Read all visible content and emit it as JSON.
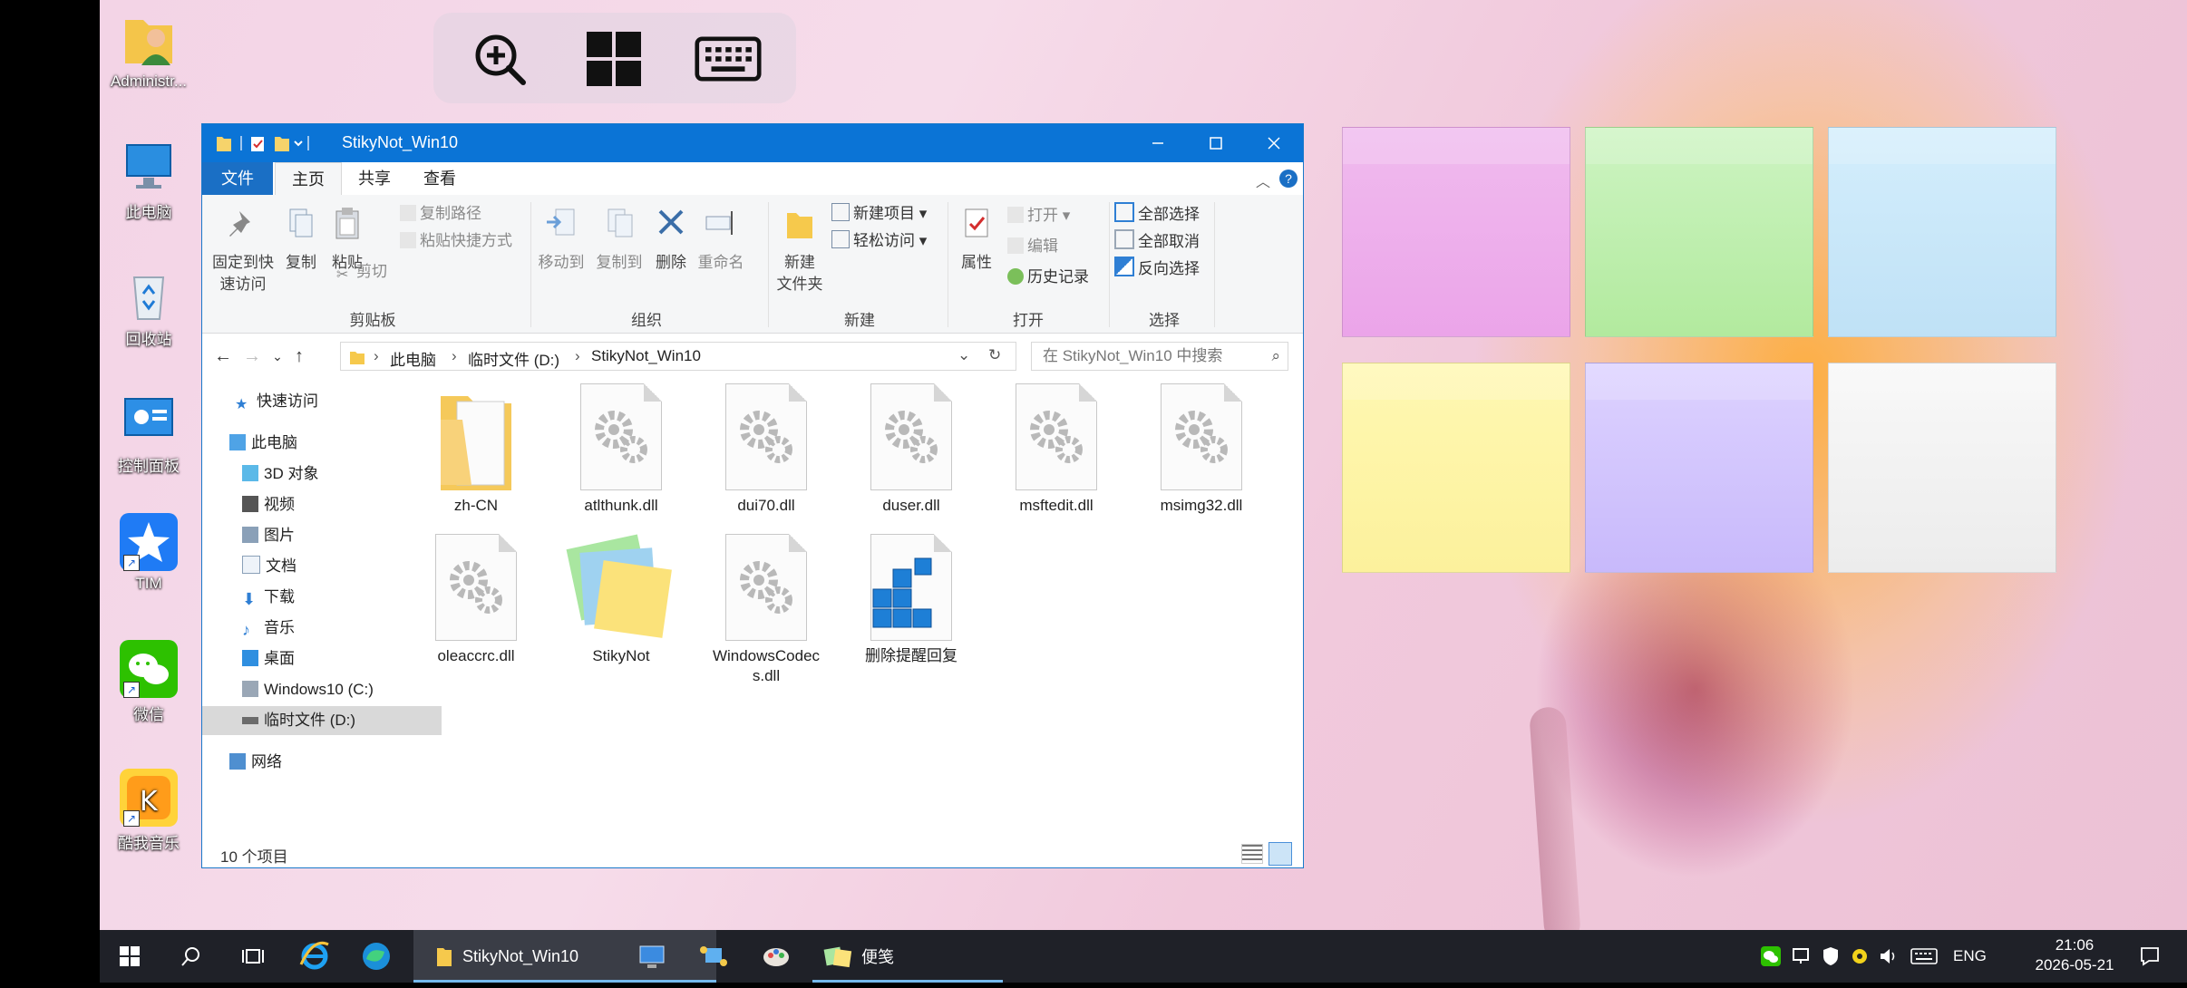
{
  "desktop_icons": [
    {
      "label": "Administr..."
    },
    {
      "label": "此电脑"
    },
    {
      "label": "回收站"
    },
    {
      "label": "控制面板"
    },
    {
      "label": "TIM"
    },
    {
      "label": "微信"
    },
    {
      "label": "酷我音乐"
    }
  ],
  "window": {
    "title": "StikyNot_Win10",
    "tabs": [
      "文件",
      "主页",
      "共享",
      "查看"
    ],
    "active_tab": "主页"
  },
  "ribbon": {
    "clipboard": {
      "pin": "固定到快\n速访问",
      "copy": "复制",
      "paste": "粘贴",
      "copy_path": "复制路径",
      "paste_shortcut": "粘贴快捷方式",
      "cut": "剪切",
      "label": "剪贴板"
    },
    "organize": {
      "move_to": "移动到",
      "copy_to": "复制到",
      "delete": "删除",
      "rename": "重命名",
      "label": "组织"
    },
    "new": {
      "new_folder": "新建\n文件夹",
      "new_item": "新建项目",
      "easy_access": "轻松访问",
      "label": "新建"
    },
    "open": {
      "properties": "属性",
      "open": "打开",
      "edit": "编辑",
      "history": "历史记录",
      "label": "打开"
    },
    "select": {
      "select_all": "全部选择",
      "select_none": "全部取消",
      "invert": "反向选择",
      "label": "选择"
    }
  },
  "address": {
    "crumbs": [
      "此电脑",
      "临时文件 (D:)",
      "StikyNot_Win10"
    ],
    "search_placeholder": "在 StikyNot_Win10 中搜索"
  },
  "tree": {
    "quick_access": "快速访问",
    "this_pc": "此电脑",
    "items": [
      "3D 对象",
      "视频",
      "图片",
      "文档",
      "下载",
      "音乐",
      "桌面",
      "Windows10 (C:)",
      "临时文件 (D:)"
    ],
    "network": "网络"
  },
  "files": [
    {
      "name": "zh-CN",
      "type": "folder"
    },
    {
      "name": "atlthunk.dll",
      "type": "dll"
    },
    {
      "name": "dui70.dll",
      "type": "dll"
    },
    {
      "name": "duser.dll",
      "type": "dll"
    },
    {
      "name": "msftedit.dll",
      "type": "dll"
    },
    {
      "name": "msimg32.dll",
      "type": "dll"
    },
    {
      "name": "oleaccrc.dll",
      "type": "dll"
    },
    {
      "name": "StikyNot",
      "type": "app"
    },
    {
      "name": "WindowsCodecs.dll",
      "type": "dll"
    },
    {
      "name": "删除提醒回复",
      "type": "registry"
    }
  ],
  "status": {
    "count": "10 个项目"
  },
  "sticky_notes": [
    {
      "color": "#f0c3ee"
    },
    {
      "color": "#c5f0b8"
    },
    {
      "color": "#c9e8f8"
    },
    {
      "color": "#fdf6a8"
    },
    {
      "color": "#d8cbff"
    },
    {
      "color": "#f3f3f3"
    }
  ],
  "taskbar": {
    "apps": [
      {
        "label": "StikyNot_Win10",
        "active": true
      },
      {
        "label": "便笺",
        "active": false
      }
    ],
    "lang": "ENG",
    "time": "21:06",
    "date": "2026-05-21"
  }
}
